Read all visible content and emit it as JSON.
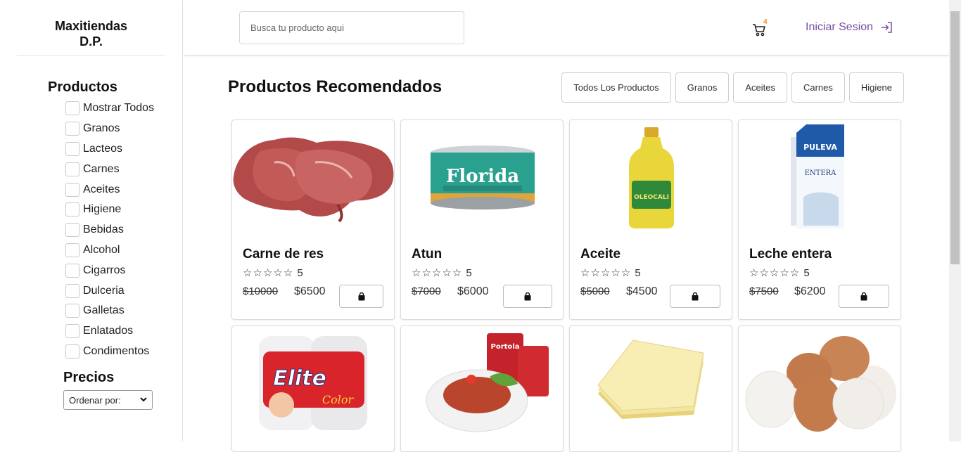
{
  "brand": {
    "line1": "Maxitiendas",
    "line2": "D.P."
  },
  "sidebar": {
    "products_title": "Productos",
    "categories": [
      "Mostrar Todos",
      "Granos",
      "Lacteos",
      "Carnes",
      "Aceites",
      "Higiene",
      "Bebidas",
      "Alcohol",
      "Cigarros",
      "Dulceria",
      "Galletas",
      "Enlatados",
      "Condimentos"
    ],
    "prices_title": "Precios",
    "sort_select": "Ordenar por:"
  },
  "header": {
    "search_placeholder": "Busca tu producto aqui",
    "cart_count": "4",
    "login_label": "Iniciar Sesion"
  },
  "main": {
    "title": "Productos Recomendados",
    "filters": [
      "Todos Los Productos",
      "Granos",
      "Aceites",
      "Carnes",
      "Higiene"
    ]
  },
  "products": [
    {
      "name": "Carne de res",
      "rating": "5",
      "old_price": "$10000",
      "price": "$6500",
      "image": "beef-steak"
    },
    {
      "name": "Atun",
      "rating": "5",
      "old_price": "$7000",
      "price": "$6000",
      "image": "tuna-can"
    },
    {
      "name": "Aceite",
      "rating": "5",
      "old_price": "$5000",
      "price": "$4500",
      "image": "oil-bottle"
    },
    {
      "name": "Leche entera",
      "rating": "5",
      "old_price": "$7500",
      "price": "$6200",
      "image": "milk-carton"
    },
    {
      "image": "toilet-paper"
    },
    {
      "image": "canned-fish-dish"
    },
    {
      "image": "cheese-slices"
    },
    {
      "image": "eggs"
    }
  ],
  "product_image_text": {
    "tuna": "Florida",
    "oil": "OLEOCALI",
    "milk_brand": "PULEVA",
    "milk_type": "ENTERA",
    "paper_brand": "Elite",
    "paper_sub": "Color",
    "sardine": "Portola"
  },
  "colors": {
    "accent": "#7a4ea0",
    "badge": "#f08c1a"
  }
}
